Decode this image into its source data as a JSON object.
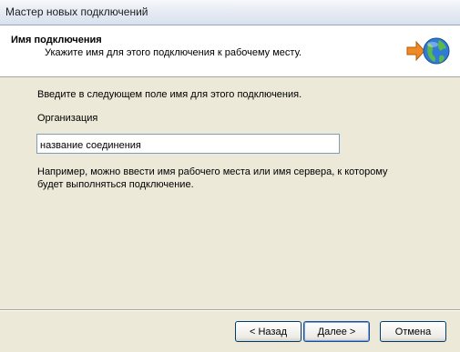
{
  "window": {
    "title": "Мастер новых подключений"
  },
  "header": {
    "title": "Имя подключения",
    "subtitle": "Укажите имя для этого подключения к рабочему месту.",
    "icon": "network-globe-icon"
  },
  "content": {
    "intro": "Введите в следующем поле имя для этого подключения.",
    "field_label": "Организация",
    "field_value": "название соединения",
    "hint": "Например, можно ввести имя рабочего места или имя сервера, к которому будет выполняться подключение."
  },
  "buttons": {
    "back_label": "< Назад",
    "next_label": "Далее >",
    "cancel_label": "Отмена"
  },
  "colors": {
    "header_bg": "#ffffff",
    "dialog_bg": "#ece9d8",
    "arrow": "#f08a24",
    "globe": "#2f7bd6"
  }
}
